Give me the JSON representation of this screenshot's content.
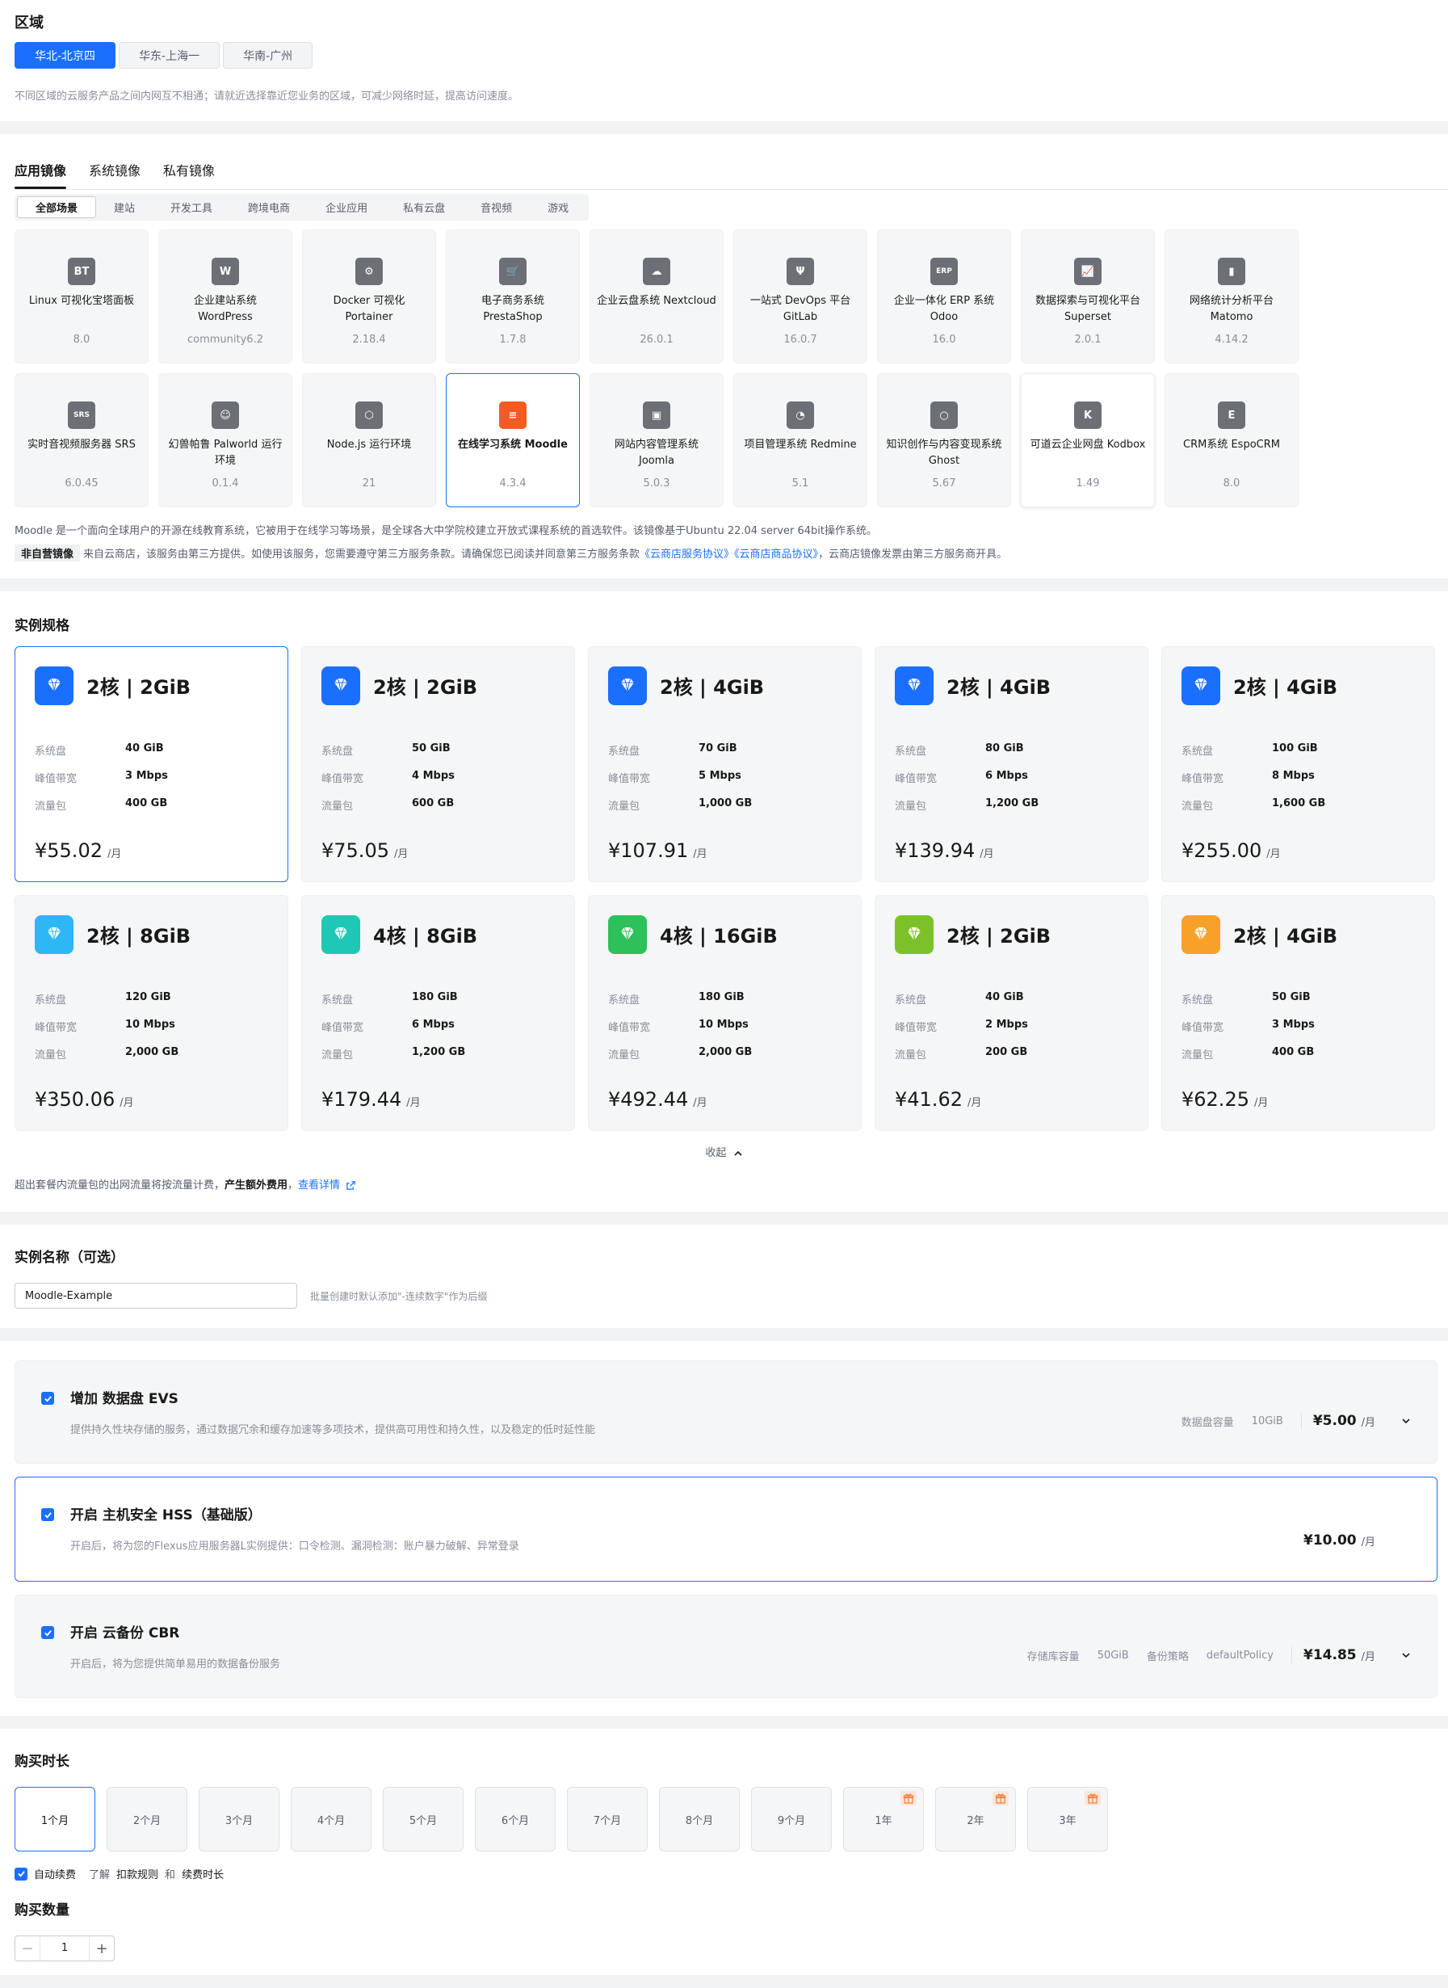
{
  "region": {
    "title": "区域",
    "options": [
      "华北-北京四",
      "华东-上海一",
      "华南-广州"
    ],
    "selected_index": 0,
    "description": "不同区域的云服务产品之间内网互不相通；请就近选择靠近您业务的区域，可减少网络时延，提高访问速度。"
  },
  "images": {
    "tabs": [
      "应用镜像",
      "系统镜像",
      "私有镜像"
    ],
    "active_tab": 0,
    "categories": [
      "全部场景",
      "建站",
      "开发工具",
      "跨境电商",
      "企业应用",
      "私有云盘",
      "音视频",
      "游戏"
    ],
    "active_category": 0,
    "items": [
      {
        "icon": "bt-panel-icon",
        "glyph": "BT",
        "name": "Linux 可视化宝塔面板",
        "version": "8.0"
      },
      {
        "icon": "wordpress-icon",
        "glyph": "W",
        "name": "企业建站系统 WordPress",
        "version": "community6.2"
      },
      {
        "icon": "docker-portainer-icon",
        "glyph": "⚙",
        "name": "Docker 可视化 Portainer",
        "version": "2.18.4"
      },
      {
        "icon": "shopping-cart-icon",
        "glyph": "🛒",
        "name": "电子商务系统 PrestaShop",
        "version": "1.7.8"
      },
      {
        "icon": "cloud-icon",
        "glyph": "☁",
        "name": "企业云盘系统 Nextcloud",
        "version": "26.0.1"
      },
      {
        "icon": "devops-icon",
        "glyph": "Ψ",
        "name": "一站式 DevOps 平台 GitLab",
        "version": "16.0.7"
      },
      {
        "icon": "erp-icon",
        "glyph": "ERP",
        "name": "企业一体化 ERP 系统 Odoo",
        "version": "16.0"
      },
      {
        "icon": "chart-line-icon",
        "glyph": "📈",
        "name": "数据探索与可视化平台 Superset",
        "version": "2.0.1"
      },
      {
        "icon": "bar-chart-icon",
        "glyph": "▮",
        "name": "网络统计分析平台 Matomo",
        "version": "4.14.2"
      },
      {
        "icon": "srs-icon",
        "glyph": "SRS",
        "name": "实时音视频服务器 SRS",
        "version": "6.0.45"
      },
      {
        "icon": "palworld-icon",
        "glyph": "☺",
        "name": "幻兽帕鲁 Palworld 运行环境",
        "version": "0.1.4"
      },
      {
        "icon": "nodejs-icon",
        "glyph": "⬡",
        "name": "Node.js 运行环境",
        "version": "21"
      },
      {
        "icon": "moodle-icon",
        "glyph": "≡",
        "name": "在线学习系统 Moodle",
        "version": "4.3.4"
      },
      {
        "icon": "joomla-icon",
        "glyph": "▣",
        "name": "网站内容管理系统 Joomla",
        "version": "5.0.3"
      },
      {
        "icon": "redmine-icon",
        "glyph": "◔",
        "name": "项目管理系统 Redmine",
        "version": "5.1"
      },
      {
        "icon": "ghost-icon",
        "glyph": "○",
        "name": "知识创作与内容变现系统 Ghost",
        "version": "5.67"
      },
      {
        "icon": "kodbox-icon",
        "glyph": "K",
        "name": "可道云企业网盘 Kodbox",
        "version": "1.49"
      },
      {
        "icon": "espocrm-icon",
        "glyph": "E",
        "name": "CRM系统 EspoCRM",
        "version": "8.0"
      }
    ],
    "selected_index": 12,
    "detail": "Moodle 是一个面向全球用户的开源在线教育系统，它被用于在线学习等场景，是全球各大中学院校建立开放式课程系统的首选软件。该镜像基于Ubuntu 22.04 server 64bit操作系统。",
    "third_party_tag": "非自营镜像",
    "third_party_text_a": "来自云商店，该服务由第三方提供。如使用该服务，您需要遵守第三方服务条款。请确保您已阅读并同意第三方服务条款",
    "link_1": "《云商店服务协议》",
    "link_2": "《云商店商品协议》",
    "third_party_text_b": "，云商店镜像发票由第三方服务商开具。"
  },
  "specs": {
    "title": "实例规格",
    "labels": {
      "disk": "系统盘",
      "bandwidth": "峰值带宽",
      "traffic": "流量包"
    },
    "per_month": "/月",
    "selected_index": 0,
    "items": [
      {
        "title": "2核 | 2GiB",
        "disk": "40 GiB",
        "bandwidth": "3 Mbps",
        "traffic": "400 GB",
        "price": "¥55.02",
        "color": "#1b6fff"
      },
      {
        "title": "2核 | 2GiB",
        "disk": "50 GiB",
        "bandwidth": "4 Mbps",
        "traffic": "600 GB",
        "price": "¥75.05",
        "color": "#1b6fff"
      },
      {
        "title": "2核 | 4GiB",
        "disk": "70 GiB",
        "bandwidth": "5 Mbps",
        "traffic": "1,000 GB",
        "price": "¥107.91",
        "color": "#1b6fff"
      },
      {
        "title": "2核 | 4GiB",
        "disk": "80 GiB",
        "bandwidth": "6 Mbps",
        "traffic": "1,200 GB",
        "price": "¥139.94",
        "color": "#1b6fff"
      },
      {
        "title": "2核 | 4GiB",
        "disk": "100 GiB",
        "bandwidth": "8 Mbps",
        "traffic": "1,600 GB",
        "price": "¥255.00",
        "color": "#1b6fff"
      },
      {
        "title": "2核 | 8GiB",
        "disk": "120 GiB",
        "bandwidth": "10 Mbps",
        "traffic": "2,000 GB",
        "price": "¥350.06",
        "color": "#2db7f5"
      },
      {
        "title": "4核 | 8GiB",
        "disk": "180 GiB",
        "bandwidth": "6 Mbps",
        "traffic": "1,200 GB",
        "price": "¥179.44",
        "color": "#1ec8b4"
      },
      {
        "title": "4核 | 16GiB",
        "disk": "180 GiB",
        "bandwidth": "10 Mbps",
        "traffic": "2,000 GB",
        "price": "¥492.44",
        "color": "#2ec05a"
      },
      {
        "title": "2核 | 2GiB",
        "disk": "40 GiB",
        "bandwidth": "2 Mbps",
        "traffic": "200 GB",
        "price": "¥41.62",
        "color": "#7dc12a"
      },
      {
        "title": "2核 | 4GiB",
        "disk": "50 GiB",
        "bandwidth": "3 Mbps",
        "traffic": "400 GB",
        "price": "¥62.25",
        "color": "#f7a12a"
      }
    ],
    "collapse_label": "收起",
    "traffic_note_a": "超出套餐内流量包的出网流量将按流量计费，",
    "traffic_note_bold": "产生额外费用",
    "traffic_note_link": "查看详情"
  },
  "instance_name": {
    "title": "实例名称（可选）",
    "value": "Moodle-Example",
    "hint": "批量创建时默认添加\"-连续数字\"作为后缀"
  },
  "addons": [
    {
      "title": "增加 数据盘 EVS",
      "desc": "提供持久性块存储的服务，通过数据冗余和缓存加速等多项技术，提供高可用性和持久性，以及稳定的低时延性能",
      "label1": "数据盘容量",
      "value1": "10GiB",
      "label2": "",
      "value2": "",
      "price": "¥5.00",
      "unit": "/月",
      "checked": true
    },
    {
      "title": "开启 主机安全 HSS（基础版）",
      "desc": "开启后，将为您的Flexus应用服务器L实例提供：口令检测、漏洞检测：账户暴力破解、异常登录",
      "price": "¥10.00",
      "unit": "/月",
      "checked": true
    },
    {
      "title": "开启 云备份 CBR",
      "desc": "开启后，将为您提供简单易用的数据备份服务",
      "label1": "存储库容量",
      "value1": "50GiB",
      "label2": "备份策略",
      "value2": "defaultPolicy",
      "price": "¥14.85",
      "unit": "/月",
      "checked": true
    }
  ],
  "duration": {
    "title": "购买时长",
    "options": [
      "1个月",
      "2个月",
      "3个月",
      "4个月",
      "5个月",
      "6个月",
      "7个月",
      "8个月",
      "9个月",
      "1年",
      "2年",
      "3年"
    ],
    "selected_index": 0,
    "auto_renew_label": "自动续费",
    "auto_renew_info_a": "了解",
    "auto_renew_rule": "扣款规则",
    "auto_renew_and": "和",
    "auto_renew_period": "续费时长"
  },
  "quantity": {
    "title": "购买数量",
    "value": "1",
    "minus": "−",
    "plus": "+"
  }
}
